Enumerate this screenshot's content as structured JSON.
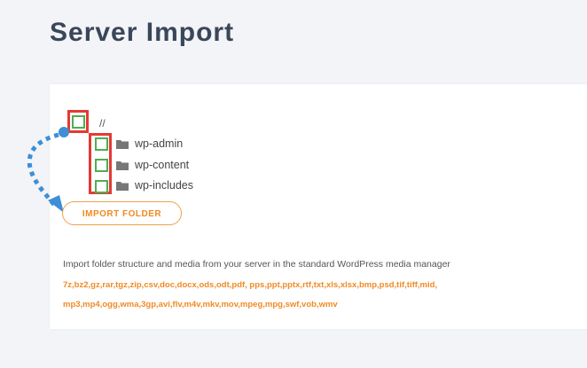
{
  "page": {
    "title": "Server Import"
  },
  "tree": {
    "root_label": "//",
    "folders": [
      {
        "label": "wp-admin",
        "icon": "folder-icon"
      },
      {
        "label": "wp-content",
        "icon": "folder-icon"
      },
      {
        "label": "wp-includes",
        "icon": "folder-icon"
      }
    ]
  },
  "actions": {
    "import_label": "IMPORT FOLDER"
  },
  "info": {
    "description": "Import folder structure and media from your server in the standard WordPress media manager",
    "extensions_line1": "7z,bz2,gz,rar,tgz,zip,csv,doc,docx,ods,odt,pdf, pps,ppt,pptx,rtf,txt,xls,xlsx,bmp,psd,tif,tiff,mid,",
    "extensions_line2": "mp3,mp4,ogg,wma,3gp,avi,flv,m4v,mkv,mov,mpeg,mpg,swf,vob,wmv"
  },
  "colors": {
    "accent": "#f08a24",
    "checkbox": "#4caf50",
    "highlight": "#e53935",
    "arrow": "#3d8fd6",
    "title": "#3a4659"
  }
}
